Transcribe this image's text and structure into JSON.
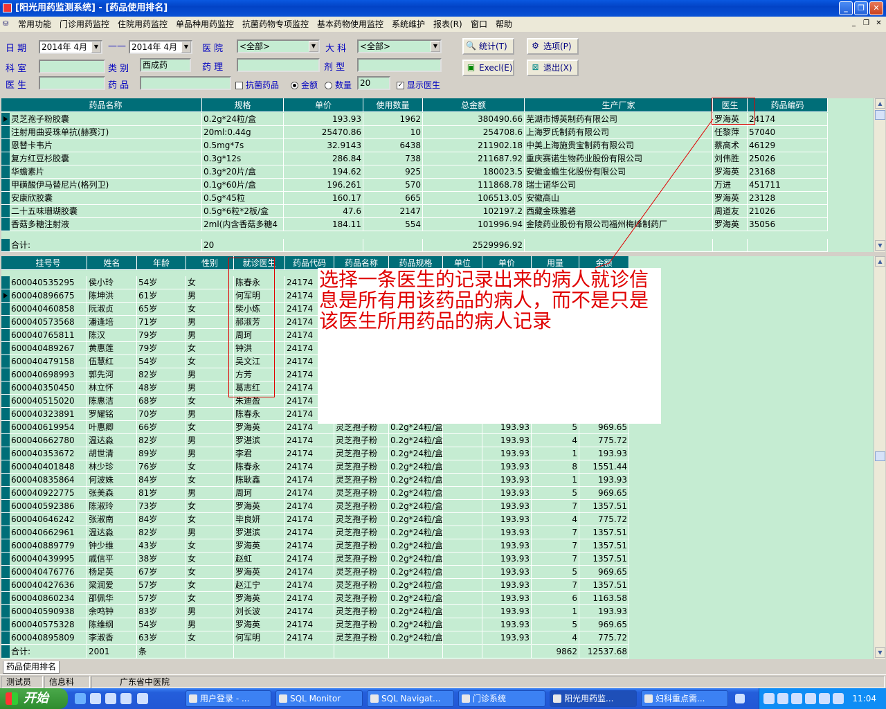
{
  "window": {
    "title": "[阳光用药监测系统] - [药品使用排名]"
  },
  "menu": [
    "常用功能",
    "门诊用药监控",
    "住院用药监控",
    "单品种用药监控",
    "抗菌药物专项监控",
    "基本药物使用监控",
    "系统维护",
    "报表(R)",
    "窗口",
    "帮助"
  ],
  "filters": {
    "date_label": "日 期",
    "date_from": "2014年 4月",
    "date_sep": "——",
    "date_to": "2014年 4月",
    "hospital_label": "医 院",
    "hospital_value": "<全部>",
    "dept_big_label": "大 科",
    "dept_big_value": "<全部>",
    "room_label": "科 室",
    "room_value": "",
    "category_label": "类 别",
    "category_value": "西成药",
    "pharm_label": "药 理",
    "pharm_value": "",
    "form_label": "剂 型",
    "form_value": "",
    "doctor_label": "医 生",
    "doctor_value": "",
    "drug_label": "药 品",
    "drug_value": "",
    "antibiotic_label": "抗菌药品",
    "amount_label": "金额",
    "quantity_label": "数量",
    "top_n": "20",
    "show_doctor_label": "显示医生"
  },
  "buttons": {
    "stats": "统计(T)",
    "options": "选项(P)",
    "excel": "Execl(E)",
    "exit": "退出(X)"
  },
  "top_grid": {
    "columns": [
      "药品名称",
      "规格",
      "单价",
      "使用数量",
      "总金额",
      "生产厂家",
      "医生",
      "药品编码"
    ],
    "rows": [
      [
        "灵芝孢子粉胶囊",
        "0.2g*24粒/盒",
        "193.93",
        "1962",
        "380490.66",
        "芜湖市博英制药有限公司",
        "罗海英",
        "24174"
      ],
      [
        "注射用曲妥珠单抗(赫赛汀)",
        "20ml:0.44g",
        "25470.86",
        "10",
        "254708.6",
        "上海罗氏制药有限公司",
        "任黎萍",
        "57040"
      ],
      [
        "恩替卡韦片",
        "0.5mg*7s",
        "32.9143",
        "6438",
        "211902.18",
        "中美上海施贵宝制药有限公司",
        "蔡高术",
        "46129"
      ],
      [
        "复方红豆杉胶囊",
        "0.3g*12s",
        "286.84",
        "738",
        "211687.92",
        "重庆赛诺生物药业股份有限公司",
        "刘伟胜",
        "25026"
      ],
      [
        "华蟾素片",
        "0.3g*20片/盒",
        "194.62",
        "925",
        "180023.5",
        "安徽金蟾生化股份有限公司",
        "罗海英",
        "23168"
      ],
      [
        "甲磺酸伊马替尼片(格列卫)",
        "0.1g*60片/盒",
        "196.261",
        "570",
        "111868.78",
        "瑞士诺华公司",
        "万进",
        "451711"
      ],
      [
        "安康欣胶囊",
        "0.5g*45粒",
        "160.17",
        "665",
        "106513.05",
        "安徽高山",
        "罗海英",
        "23128"
      ],
      [
        "二十五味珊瑚胶囊",
        "0.5g*6粒*2板/盒",
        "47.6",
        "2147",
        "102197.2",
        "西藏金珠雅砻",
        "周道友",
        "21026"
      ],
      [
        "香菇多糖注射液",
        "2ml(内含香菇多糖4",
        "184.11",
        "554",
        "101996.94",
        "金陵药业股份有限公司福州梅峰制药厂",
        "罗海英",
        "35056"
      ]
    ],
    "total_label": "合计:",
    "total_count": "20",
    "total_amount": "2529996.92"
  },
  "bottom_grid": {
    "columns": [
      "挂号号",
      "姓名",
      "年龄",
      "性别",
      "就诊医生",
      "药品代码",
      "药品名称",
      "药品规格",
      "单位",
      "单价",
      "用量",
      "金额"
    ],
    "rows": [
      [
        "600040535295",
        "侯小玲",
        "54岁",
        "女",
        "陈春永",
        "24174",
        "",
        "",
        "",
        "",
        "",
        ""
      ],
      [
        "600040896675",
        "陈坤洪",
        "61岁",
        "男",
        "何军明",
        "24174",
        "",
        "",
        "",
        "",
        "",
        ""
      ],
      [
        "600040460858",
        "阮淑贞",
        "65岁",
        "女",
        "柴小炼",
        "24174",
        "",
        "",
        "",
        "",
        "",
        ""
      ],
      [
        "600040573568",
        "潘逢培",
        "71岁",
        "男",
        "郝淑芳",
        "24174",
        "",
        "",
        "",
        "",
        "",
        ""
      ],
      [
        "600040765811",
        "陈汉",
        "79岁",
        "男",
        "周珂",
        "24174",
        "",
        "",
        "",
        "",
        "",
        ""
      ],
      [
        "600040489267",
        "黄惠莲",
        "79岁",
        "女",
        "钟洪",
        "24174",
        "",
        "",
        "",
        "",
        "",
        ""
      ],
      [
        "600040479158",
        "伍慧红",
        "54岁",
        "女",
        "吴文江",
        "24174",
        "",
        "",
        "",
        "",
        "",
        ""
      ],
      [
        "600040698993",
        "郭先河",
        "82岁",
        "男",
        "方芳",
        "24174",
        "",
        "",
        "",
        "",
        "",
        ""
      ],
      [
        "600040350450",
        "林立怀",
        "48岁",
        "男",
        "葛志红",
        "24174",
        "",
        "",
        "",
        "",
        "",
        ""
      ],
      [
        "600040515020",
        "陈惠洁",
        "68岁",
        "女",
        "朱迪盈",
        "24174",
        "",
        "",
        "",
        "",
        "",
        ""
      ],
      [
        "600040323891",
        "罗耀铭",
        "70岁",
        "男",
        "陈春永",
        "24174",
        "",
        "",
        "",
        "",
        "",
        ""
      ],
      [
        "600040619954",
        "叶惠卿",
        "66岁",
        "女",
        "罗海英",
        "24174",
        "灵芝孢子粉",
        "0.2g*24粒/盒",
        "",
        "193.93",
        "5",
        "969.65"
      ],
      [
        "600040662780",
        "温达淼",
        "82岁",
        "男",
        "罗湛滨",
        "24174",
        "灵芝孢子粉",
        "0.2g*24粒/盒",
        "",
        "193.93",
        "4",
        "775.72"
      ],
      [
        "600040353672",
        "胡世清",
        "89岁",
        "男",
        "李君",
        "24174",
        "灵芝孢子粉",
        "0.2g*24粒/盒",
        "",
        "193.93",
        "1",
        "193.93"
      ],
      [
        "600040401848",
        "林少珍",
        "76岁",
        "女",
        "陈春永",
        "24174",
        "灵芝孢子粉",
        "0.2g*24粒/盒",
        "",
        "193.93",
        "8",
        "1551.44"
      ],
      [
        "600040835864",
        "何波姝",
        "84岁",
        "女",
        "陈耿鑫",
        "24174",
        "灵芝孢子粉",
        "0.2g*24粒/盒",
        "",
        "193.93",
        "1",
        "193.93"
      ],
      [
        "600040922775",
        "张美森",
        "81岁",
        "男",
        "周珂",
        "24174",
        "灵芝孢子粉",
        "0.2g*24粒/盒",
        "",
        "193.93",
        "5",
        "969.65"
      ],
      [
        "600040592386",
        "陈淑玲",
        "73岁",
        "女",
        "罗海英",
        "24174",
        "灵芝孢子粉",
        "0.2g*24粒/盒",
        "",
        "193.93",
        "7",
        "1357.51"
      ],
      [
        "600040646242",
        "张淑南",
        "84岁",
        "女",
        "毕良妍",
        "24174",
        "灵芝孢子粉",
        "0.2g*24粒/盒",
        "",
        "193.93",
        "4",
        "775.72"
      ],
      [
        "600040662961",
        "温达淼",
        "82岁",
        "男",
        "罗湛滨",
        "24174",
        "灵芝孢子粉",
        "0.2g*24粒/盒",
        "",
        "193.93",
        "7",
        "1357.51"
      ],
      [
        "600040889779",
        "钟少维",
        "43岁",
        "女",
        "罗海英",
        "24174",
        "灵芝孢子粉",
        "0.2g*24粒/盒",
        "",
        "193.93",
        "7",
        "1357.51"
      ],
      [
        "600040439995",
        "戚信平",
        "38岁",
        "女",
        "赵虹",
        "24174",
        "灵芝孢子粉",
        "0.2g*24粒/盒",
        "",
        "193.93",
        "7",
        "1357.51"
      ],
      [
        "600040476776",
        "杨足英",
        "67岁",
        "女",
        "罗海英",
        "24174",
        "灵芝孢子粉",
        "0.2g*24粒/盒",
        "",
        "193.93",
        "5",
        "969.65"
      ],
      [
        "600040427636",
        "梁润爱",
        "57岁",
        "女",
        "赵江宁",
        "24174",
        "灵芝孢子粉",
        "0.2g*24粒/盒",
        "",
        "193.93",
        "7",
        "1357.51"
      ],
      [
        "600040860234",
        "邵佩华",
        "57岁",
        "女",
        "罗海英",
        "24174",
        "灵芝孢子粉",
        "0.2g*24粒/盒",
        "",
        "193.93",
        "6",
        "1163.58"
      ],
      [
        "600040590938",
        "余鸣钟",
        "83岁",
        "男",
        "刘长波",
        "24174",
        "灵芝孢子粉",
        "0.2g*24粒/盒",
        "",
        "193.93",
        "1",
        "193.93"
      ],
      [
        "600040575328",
        "陈维纲",
        "54岁",
        "男",
        "罗海英",
        "24174",
        "灵芝孢子粉",
        "0.2g*24粒/盒",
        "",
        "193.93",
        "5",
        "969.65"
      ],
      [
        "600040895809",
        "李淑香",
        "63岁",
        "女",
        "何军明",
        "24174",
        "灵芝孢子粉",
        "0.2g*24粒/盒",
        "",
        "193.93",
        "4",
        "775.72"
      ]
    ],
    "total_label": "合计:",
    "total_count": "2001",
    "total_unit": "条",
    "total_qty": "9862",
    "total_amount": "12537.68"
  },
  "annotation": {
    "text": "选择一条医生的记录出来的病人就诊信息是所有用该药品的病人，而不是只是该医生所用药品的病人记录",
    "color": "#e00000"
  },
  "tab": "药品使用排名",
  "status": [
    "测试员",
    "信息科",
    "广东省中医院"
  ],
  "taskbar": {
    "start": "开始",
    "items": [
      "用户登录 - ...",
      "SQL Monitor",
      "SQL Navigat...",
      "门诊系统",
      "阳光用药监...",
      "妇科重点需..."
    ],
    "clock": "11:04"
  },
  "colors": {
    "grid_bg": "#c5ecd2",
    "header_bg": "#006e78",
    "label_blue": "#0000c0"
  }
}
